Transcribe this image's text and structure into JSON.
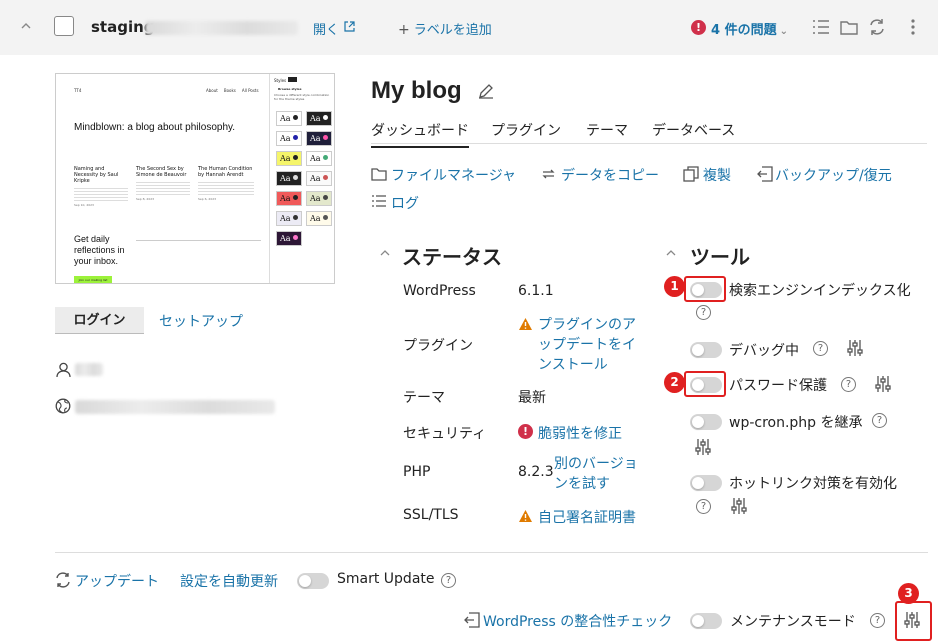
{
  "topbar": {
    "site_name": "staging",
    "open_label": "開く",
    "add_label": "ラベルを追加",
    "issues_label": "4 件の問題"
  },
  "site": {
    "title": "My blog",
    "tabs": [
      "ダッシュボード",
      "プラグイン",
      "テーマ",
      "データベース"
    ],
    "actions": {
      "file_manager": "ファイルマネージャ",
      "copy_data": "データをコピー",
      "clone": "複製",
      "backup": "バックアップ/復元",
      "log": "ログ"
    },
    "login_button": "ログイン",
    "setup_link": "セットアップ"
  },
  "thumbnail": {
    "logo": "TT4",
    "nav": [
      "About",
      "Books",
      "All Posts"
    ],
    "headline": "Mindblown: a blog about philosophy.",
    "posts": [
      {
        "title": "Naming and Necessity by Saul Kripke",
        "date": "Sep 10, 2023"
      },
      {
        "title": "The Second Sex by Simone de Beauvoir",
        "date": "Sep 8, 2023"
      },
      {
        "title": "The Human Condition by Hannah Arendt",
        "date": "Sep 6, 2023"
      }
    ],
    "cta": "Get daily reflections in your inbox.",
    "cta_button": "Join our mailing list",
    "panel_title": "Styles",
    "panel_sub": "Browse styles",
    "panel_desc": "Choose a different style combination for the theme styles",
    "swatch_text": "Aa"
  },
  "status": {
    "heading": "ステータス",
    "rows": [
      {
        "label": "WordPress",
        "value": "6.1.1"
      },
      {
        "label": "プラグイン",
        "value": "プラグインのアップデートをインストール"
      },
      {
        "label": "テーマ",
        "value": "最新"
      },
      {
        "label": "セキュリティ",
        "value": "脆弱性を修正"
      },
      {
        "label": "PHP",
        "value": "8.2.3",
        "link": "別のバージョンを試す"
      },
      {
        "label": "SSL/TLS",
        "value": "自己署名証明書"
      }
    ]
  },
  "tools": {
    "heading": "ツール",
    "items": [
      {
        "label": "検索エンジンインデックス化"
      },
      {
        "label": "デバッグ中"
      },
      {
        "label": "パスワード保護"
      },
      {
        "label": "wp-cron.php を継承"
      },
      {
        "label": "ホットリンク対策を有効化"
      }
    ]
  },
  "footer": {
    "update": "アップデート",
    "auto_update": "設定を自動更新",
    "smart_update": "Smart Update",
    "integrity": "WordPress の整合性チェック",
    "maintenance": "メンテナンスモード"
  },
  "callouts": [
    "1",
    "2",
    "3"
  ],
  "colors": {
    "link": "#1a73a8",
    "danger": "#e02020",
    "warning": "#e07b00",
    "issue": "#d0304a"
  }
}
